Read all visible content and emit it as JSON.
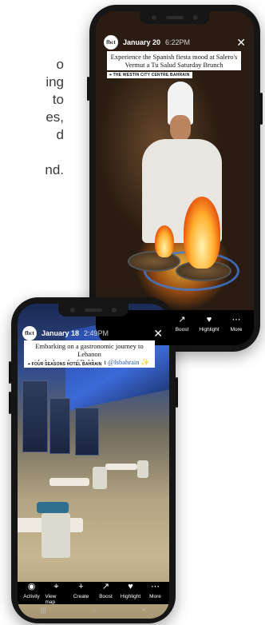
{
  "background_text": [
    "o",
    "ing",
    "to",
    "es,",
    "d",
    "",
    "nd."
  ],
  "stories": [
    {
      "account_initials": "fbct",
      "date": "January 20",
      "time": "6:22PM",
      "caption": "Experience the Spanish fiesta mood at Salero's Vermut a Tu Salud Saturday Brunch",
      "location": "⌖ THE WESTIN CITY CENTRE BAHRAIN",
      "actions": [
        {
          "icon": "boost-icon",
          "glyph": "↗",
          "label": "Boost"
        },
        {
          "icon": "highlight-icon",
          "glyph": "♥",
          "label": "Highlight"
        },
        {
          "icon": "more-icon",
          "glyph": "⋯",
          "label": "More"
        }
      ]
    },
    {
      "account_initials": "fbct",
      "date": "January 18",
      "time": "2:49PM",
      "caption_line1": "Embarking on a gastronomic journey to Lebanon",
      "caption_line2_prefix": "with the launch of Byblos at ",
      "caption_mention": "@fsbahrain",
      "caption_emoji": "✨",
      "location": "⌖ FOUR SEASONS HOTEL BAHRAIN",
      "actions": [
        {
          "icon": "activity-icon",
          "glyph": "◉",
          "label": "Activity"
        },
        {
          "icon": "view-map-icon",
          "glyph": "⌖",
          "label": "View map"
        },
        {
          "icon": "create-icon",
          "glyph": "+",
          "label": "Create"
        },
        {
          "icon": "boost-icon",
          "glyph": "↗",
          "label": "Boost"
        },
        {
          "icon": "highlight-icon",
          "glyph": "♥",
          "label": "Highlight"
        },
        {
          "icon": "more-icon",
          "glyph": "⋯",
          "label": "More"
        }
      ],
      "nav": [
        "|||",
        "○",
        "<"
      ]
    }
  ],
  "colors": {
    "accent_blue": "#3c6ad8",
    "frame": "#161616"
  }
}
